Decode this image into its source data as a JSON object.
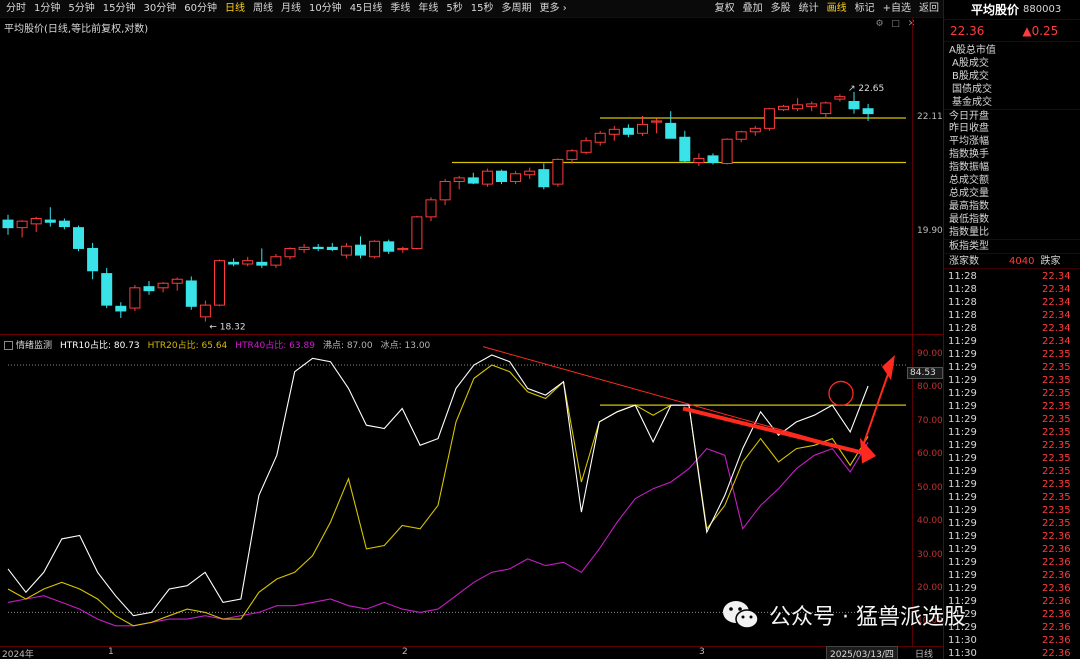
{
  "toolbar": {
    "periods": [
      "分时",
      "1分钟",
      "5分钟",
      "15分钟",
      "30分钟",
      "60分钟",
      "日线",
      "周线",
      "月线",
      "10分钟",
      "45日线",
      "季线",
      "年线",
      "5秒",
      "15秒",
      "多周期",
      "更多 ›"
    ],
    "active_period": "日线",
    "tools": [
      "复权",
      "叠加",
      "多股",
      "统计",
      "画线",
      "标记",
      "+自选",
      "返回"
    ],
    "active_tool": "画线"
  },
  "main_chart": {
    "title": "平均股价(日线,等比前复权,对数)",
    "price_ticks": [
      "22.11",
      "19.90"
    ],
    "low_label": "18.32",
    "high_label": "22.65"
  },
  "indicator": {
    "name": "情绪监测",
    "series_labels": [
      "HTR10占比: 80.73",
      "HTR20占比: 65.64",
      "HTR40占比: 63.89"
    ],
    "hot_label": "沸点: 87.00",
    "cold_label": "冰点: 13.00",
    "ticks": [
      "90.00",
      "80.00",
      "70.00",
      "60.00",
      "50.00",
      "40.00",
      "30.00",
      "20.00",
      "10.00"
    ],
    "current_value": "84.53"
  },
  "date_axis": {
    "labels": [
      "2024年",
      "1",
      "2",
      "3"
    ],
    "cursor_date": "2025/03/13/四",
    "period_label": "日线"
  },
  "side_panel": {
    "name": "平均股价",
    "code": "880003",
    "price": "22.36",
    "change": "▲0.25",
    "fields": [
      "A股总市值",
      "A股成交",
      "B股成交",
      "国债成交",
      "基金成交",
      "今日开盘",
      "昨日收盘",
      "平均涨幅",
      "指数换手",
      "指数振幅",
      "总成交额",
      "总成交量",
      "最高指数",
      "最低指数",
      "指数量比",
      "板指类型"
    ],
    "updown": {
      "label": "涨家数",
      "value": "4040",
      "label2": "跌家"
    },
    "ticks": [
      {
        "t": "11:28",
        "v": "22.34"
      },
      {
        "t": "11:28",
        "v": "22.34"
      },
      {
        "t": "11:28",
        "v": "22.34"
      },
      {
        "t": "11:28",
        "v": "22.34"
      },
      {
        "t": "11:28",
        "v": "22.34"
      },
      {
        "t": "11:29",
        "v": "22.34"
      },
      {
        "t": "11:29",
        "v": "22.35"
      },
      {
        "t": "11:29",
        "v": "22.35"
      },
      {
        "t": "11:29",
        "v": "22.35"
      },
      {
        "t": "11:29",
        "v": "22.35"
      },
      {
        "t": "11:29",
        "v": "22.35"
      },
      {
        "t": "11:29",
        "v": "22.35"
      },
      {
        "t": "11:29",
        "v": "22.35"
      },
      {
        "t": "11:29",
        "v": "22.35"
      },
      {
        "t": "11:29",
        "v": "22.35"
      },
      {
        "t": "11:29",
        "v": "22.35"
      },
      {
        "t": "11:29",
        "v": "22.35"
      },
      {
        "t": "11:29",
        "v": "22.35"
      },
      {
        "t": "11:29",
        "v": "22.35"
      },
      {
        "t": "11:29",
        "v": "22.35"
      },
      {
        "t": "11:29",
        "v": "22.36"
      },
      {
        "t": "11:29",
        "v": "22.36"
      },
      {
        "t": "11:29",
        "v": "22.36"
      },
      {
        "t": "11:29",
        "v": "22.36"
      },
      {
        "t": "11:29",
        "v": "22.36"
      },
      {
        "t": "11:29",
        "v": "22.36"
      },
      {
        "t": "11:29",
        "v": "22.36"
      },
      {
        "t": "11:29",
        "v": "22.36"
      },
      {
        "t": "11:30",
        "v": "22.36"
      },
      {
        "t": "11:30",
        "v": "22.36"
      },
      {
        "t": "11:30",
        "v": "22.36"
      }
    ]
  },
  "watermark": {
    "text": "公众号 · 猛兽派选股"
  },
  "colors": {
    "up": "#ff3b3b",
    "down": "#39e3e8",
    "yellow": "#d6c400",
    "magenta": "#c51ec5",
    "arrow": "#ff2a1f"
  },
  "chart_data": [
    {
      "type": "candlestick",
      "title": "平均股价(日线,等比前复权,对数)",
      "log_scale": true,
      "ylim": [
        18.0,
        23.1
      ],
      "y_ticks": [
        19.9,
        22.11
      ],
      "annotations": [
        {
          "label": "18.32",
          "value": 18.32
        },
        {
          "label": "22.65",
          "value": 22.65
        }
      ],
      "hlines": [
        22.11,
        21.22
      ],
      "ohlc": [
        [
          20.12,
          20.22,
          19.85,
          19.98
        ],
        [
          19.98,
          20.12,
          19.8,
          20.1
        ],
        [
          20.05,
          20.18,
          19.9,
          20.15
        ],
        [
          20.12,
          20.36,
          20.0,
          20.08
        ],
        [
          20.1,
          20.15,
          19.95,
          20.0
        ],
        [
          19.98,
          20.02,
          19.55,
          19.6
        ],
        [
          19.6,
          19.7,
          19.05,
          19.2
        ],
        [
          19.15,
          19.25,
          18.55,
          18.6
        ],
        [
          18.58,
          18.65,
          18.38,
          18.5
        ],
        [
          18.55,
          18.95,
          18.5,
          18.9
        ],
        [
          18.92,
          19.02,
          18.78,
          18.85
        ],
        [
          18.9,
          19.0,
          18.82,
          18.98
        ],
        [
          18.98,
          19.08,
          18.85,
          19.05
        ],
        [
          19.02,
          19.1,
          18.52,
          18.58
        ],
        [
          18.4,
          18.68,
          18.32,
          18.6
        ],
        [
          18.6,
          19.4,
          18.58,
          19.38
        ],
        [
          19.35,
          19.42,
          19.28,
          19.32
        ],
        [
          19.32,
          19.45,
          19.28,
          19.38
        ],
        [
          19.35,
          19.6,
          19.25,
          19.3
        ],
        [
          19.3,
          19.5,
          19.25,
          19.45
        ],
        [
          19.45,
          19.62,
          19.4,
          19.6
        ],
        [
          19.58,
          19.68,
          19.52,
          19.62
        ],
        [
          19.62,
          19.68,
          19.55,
          19.6
        ],
        [
          19.62,
          19.7,
          19.55,
          19.58
        ],
        [
          19.48,
          19.7,
          19.42,
          19.64
        ],
        [
          19.66,
          19.82,
          19.42,
          19.48
        ],
        [
          19.45,
          19.75,
          19.42,
          19.73
        ],
        [
          19.72,
          19.76,
          19.5,
          19.55
        ],
        [
          19.58,
          19.63,
          19.52,
          19.6
        ],
        [
          19.6,
          20.2,
          19.58,
          20.18
        ],
        [
          20.18,
          20.55,
          20.1,
          20.5
        ],
        [
          20.5,
          20.9,
          20.4,
          20.85
        ],
        [
          20.85,
          20.96,
          20.7,
          20.92
        ],
        [
          20.92,
          21.02,
          20.8,
          20.82
        ],
        [
          20.8,
          21.1,
          20.75,
          21.05
        ],
        [
          21.05,
          21.08,
          20.8,
          20.85
        ],
        [
          20.85,
          21.05,
          20.8,
          21.0
        ],
        [
          20.98,
          21.12,
          20.9,
          21.05
        ],
        [
          21.08,
          21.2,
          20.7,
          20.75
        ],
        [
          20.8,
          21.3,
          20.75,
          21.28
        ],
        [
          21.28,
          21.48,
          21.2,
          21.45
        ],
        [
          21.42,
          21.72,
          21.38,
          21.65
        ],
        [
          21.62,
          21.85,
          21.55,
          21.8
        ],
        [
          21.78,
          21.95,
          21.65,
          21.88
        ],
        [
          21.9,
          21.98,
          21.72,
          21.78
        ],
        [
          21.8,
          22.15,
          21.75,
          21.98
        ],
        [
          22.05,
          22.1,
          21.8,
          22.05
        ],
        [
          22.0,
          22.25,
          21.7,
          21.7
        ],
        [
          21.72,
          21.85,
          21.22,
          21.25
        ],
        [
          21.22,
          21.4,
          21.15,
          21.3
        ],
        [
          21.35,
          21.4,
          21.18,
          21.22
        ],
        [
          21.2,
          21.7,
          21.18,
          21.68
        ],
        [
          21.68,
          21.85,
          21.62,
          21.83
        ],
        [
          21.83,
          21.95,
          21.75,
          21.9
        ],
        [
          21.9,
          22.32,
          21.85,
          22.3
        ],
        [
          22.28,
          22.38,
          22.25,
          22.35
        ],
        [
          22.3,
          22.52,
          22.25,
          22.38
        ],
        [
          22.35,
          22.45,
          22.25,
          22.4
        ],
        [
          22.2,
          22.45,
          22.1,
          22.42
        ],
        [
          22.5,
          22.6,
          22.45,
          22.55
        ],
        [
          22.45,
          22.65,
          22.2,
          22.3
        ],
        [
          22.3,
          22.4,
          22.05,
          22.2
        ]
      ]
    },
    {
      "type": "line",
      "name": "情绪监测",
      "ylim": [
        7,
        93
      ],
      "y_ticks": [
        90,
        80,
        70,
        60,
        50,
        40,
        30,
        20,
        10
      ],
      "hlines": [
        87,
        13
      ],
      "series": [
        {
          "name": "HTR10占比",
          "color": "#ffffff",
          "values": [
            26,
            19,
            25,
            35,
            36,
            25,
            18,
            12,
            13,
            20,
            21,
            25,
            16,
            17,
            48,
            60,
            85,
            89,
            88,
            80,
            69,
            68,
            74,
            63,
            65,
            80,
            87,
            90,
            88,
            80,
            78,
            82,
            43,
            70,
            73,
            75,
            64,
            75,
            75,
            37,
            48,
            62,
            73,
            66,
            70,
            72,
            75,
            67,
            80.73
          ]
        },
        {
          "name": "HTR20占比",
          "color": "#d6c400",
          "values": [
            20,
            17,
            20,
            22,
            20,
            17,
            12,
            9,
            10,
            12,
            14,
            13,
            11,
            11,
            19,
            23,
            25,
            30,
            40,
            53,
            32,
            33,
            39,
            38,
            45,
            70,
            83,
            87,
            85,
            79,
            77,
            82,
            52,
            70,
            73,
            75,
            72,
            75,
            75,
            38,
            45,
            58,
            65,
            58,
            62,
            63,
            65,
            57,
            65.64
          ]
        },
        {
          "name": "HTR40占比",
          "color": "#c51ec5",
          "values": [
            16,
            17,
            18,
            16,
            14,
            11,
            9,
            9,
            10,
            11,
            11,
            12,
            11,
            12,
            13,
            15,
            15,
            16,
            17,
            15,
            14,
            16,
            14,
            13,
            14,
            18,
            22,
            25,
            26,
            29,
            27,
            28,
            25,
            32,
            40,
            47,
            50,
            52,
            56,
            62,
            60,
            38,
            45,
            50,
            56,
            60,
            62,
            55,
            63.89
          ]
        }
      ]
    }
  ]
}
